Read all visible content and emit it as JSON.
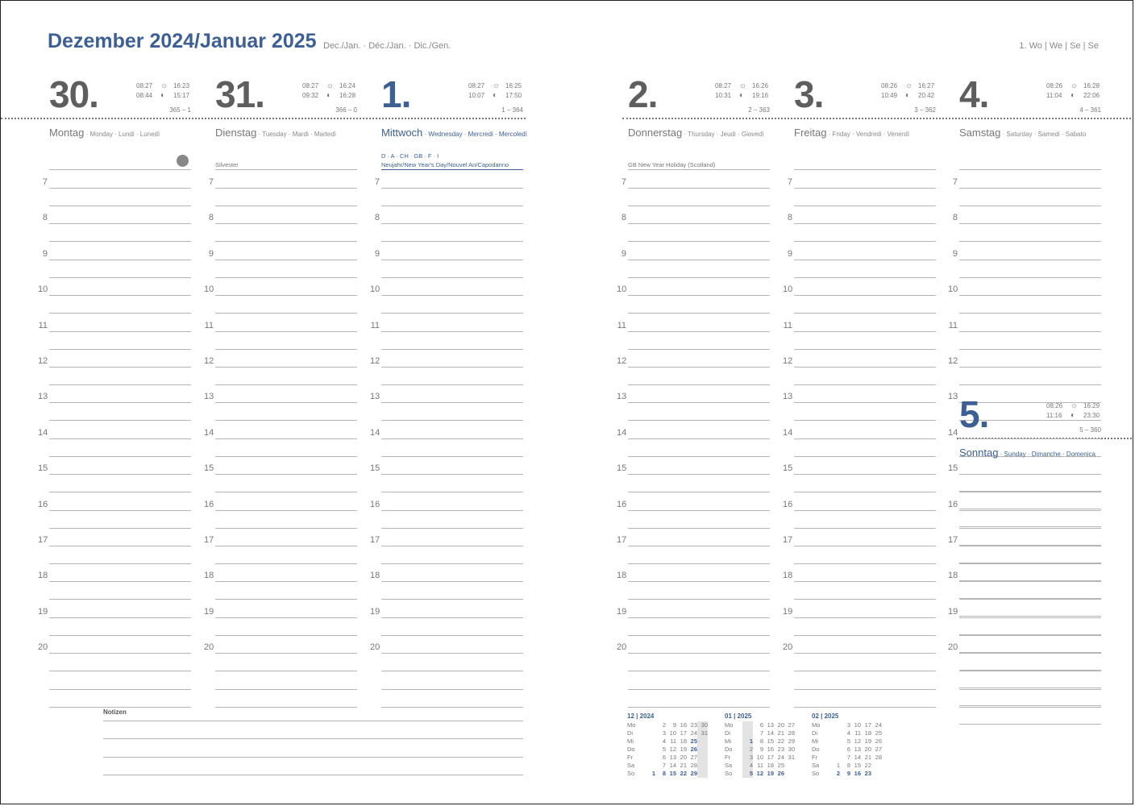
{
  "header": {
    "title": "Dezember 2024/Januar 2025",
    "subtitle": "Dec./Jan. · Déc./Jan. · Dic./Gen.",
    "week_label": "1. Wo | We | Se | Se"
  },
  "hours": [
    "7",
    "8",
    "9",
    "10",
    "11",
    "12",
    "13",
    "14",
    "15",
    "16",
    "17",
    "18",
    "19",
    "20"
  ],
  "days": [
    {
      "num": "30.",
      "name": "Montag",
      "sub": " · Monday · Lundi · Lunedì",
      "sunrise": "08:27",
      "sunset": "16:23",
      "moonrise": "08:44",
      "moonset": "15:17",
      "year_count": "365 – 1",
      "holiday_region": "",
      "holiday": ""
    },
    {
      "num": "31.",
      "name": "Dienstag",
      "sub": " · Tuesday · Mardi · Martedì",
      "sunrise": "08:27",
      "sunset": "16:24",
      "moonrise": "09:32",
      "moonset": "16:28",
      "year_count": "366 – 0",
      "holiday_region": "",
      "holiday": "Silvester"
    },
    {
      "num": "1.",
      "name": "Mittwoch",
      "sub": " · Wednesday · Mercredi · Mercoledì",
      "sunrise": "08:27",
      "sunset": "16:25",
      "moonrise": "10:07",
      "moonset": "17:50",
      "year_count": "1 – 364",
      "holiday_region": "D · A · CH · GB · F · I",
      "holiday": "Neujahr/New Year's Day/Nouvel An/Capodanno"
    },
    {
      "num": "2.",
      "name": "Donnerstag",
      "sub": " · Thursday · Jeudi · Giovedì",
      "sunrise": "08:27",
      "sunset": "16:26",
      "moonrise": "10:31",
      "moonset": "19:16",
      "year_count": "2 – 363",
      "holiday_region": "",
      "holiday": "GB   New Year Holiday (Scotland)"
    },
    {
      "num": "3.",
      "name": "Freitag",
      "sub": " · Friday · Vendredi · Venerdì",
      "sunrise": "08:26",
      "sunset": "16:27",
      "moonrise": "10:49",
      "moonset": "20:42",
      "year_count": "3 – 362",
      "holiday_region": "",
      "holiday": ""
    },
    {
      "num": "4.",
      "name": "Samstag",
      "sub": " · Saturday · Samedi · Sabato",
      "sunrise": "08:26",
      "sunset": "16:28",
      "moonrise": "11:04",
      "moonset": "22:06",
      "year_count": "4 – 361",
      "holiday_region": "",
      "holiday": ""
    },
    {
      "num": "5.",
      "name": "Sonntag",
      "sub": " · Sunday · Dimanche · Domenica",
      "sunrise": "08:26",
      "sunset": "16:29",
      "moonrise": "11:16",
      "moonset": "23:30",
      "year_count": "5 – 360",
      "holiday_region": "",
      "holiday": ""
    }
  ],
  "notes": {
    "title": "Notizen"
  },
  "mini_calendars": [
    {
      "header": "12 | 2024",
      "rows": [
        [
          "Mo",
          "",
          "2",
          "9",
          "16",
          "23",
          "30"
        ],
        [
          "Di",
          "",
          "3",
          "10",
          "17",
          "24",
          "31"
        ],
        [
          "Mi",
          "",
          "4",
          "11",
          "18",
          "25",
          ""
        ],
        [
          "Do",
          "",
          "5",
          "12",
          "19",
          "26",
          ""
        ],
        [
          "Fr",
          "",
          "6",
          "13",
          "20",
          "27",
          ""
        ],
        [
          "Sa",
          "",
          "7",
          "14",
          "21",
          "28",
          ""
        ],
        [
          "So",
          "1",
          "8",
          "15",
          "22",
          "29",
          ""
        ]
      ]
    },
    {
      "header": "01 | 2025",
      "rows": [
        [
          "Mo",
          "",
          "6",
          "13",
          "20",
          "27"
        ],
        [
          "Di",
          "",
          "7",
          "14",
          "21",
          "28"
        ],
        [
          "Mi",
          "1",
          "8",
          "15",
          "22",
          "29"
        ],
        [
          "Do",
          "2",
          "9",
          "16",
          "23",
          "30"
        ],
        [
          "Fr",
          "3",
          "10",
          "17",
          "24",
          "31"
        ],
        [
          "Sa",
          "4",
          "11",
          "18",
          "25",
          ""
        ],
        [
          "So",
          "5",
          "12",
          "19",
          "26",
          ""
        ]
      ]
    },
    {
      "header": "02 | 2025",
      "rows": [
        [
          "Mo",
          "",
          "3",
          "10",
          "17",
          "24"
        ],
        [
          "Di",
          "",
          "4",
          "11",
          "18",
          "25"
        ],
        [
          "Mi",
          "",
          "5",
          "12",
          "19",
          "26"
        ],
        [
          "Do",
          "",
          "6",
          "13",
          "20",
          "27"
        ],
        [
          "Fr",
          "",
          "7",
          "14",
          "21",
          "28"
        ],
        [
          "Sa",
          "1",
          "8",
          "15",
          "22",
          ""
        ],
        [
          "So",
          "2",
          "9",
          "16",
          "23",
          ""
        ]
      ]
    }
  ],
  "colors": {
    "accent": "#3d5f92",
    "text": "#555555",
    "rule": "#b5b5b5"
  },
  "icons": {
    "sun": "sun-icon",
    "moon": "moon-icon",
    "marker": "circle-marker-icon"
  }
}
